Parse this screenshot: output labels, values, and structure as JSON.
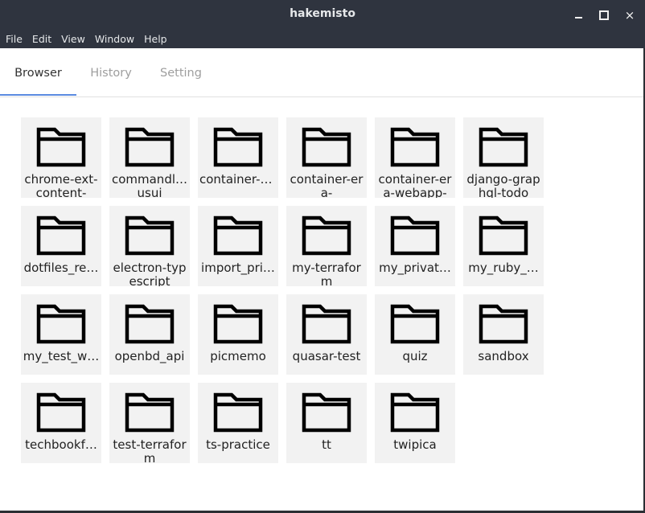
{
  "window": {
    "title": "hakemisto",
    "controls": {
      "minimize": "minimize",
      "maximize": "maximize",
      "close": "×"
    }
  },
  "menu": [
    "File",
    "Edit",
    "Window",
    "Help"
  ],
  "menu_labels": {
    "file": "File",
    "edit": "Edit",
    "view": "View",
    "window": "Window",
    "help": "Help"
  },
  "tabs": [
    {
      "label": "Browser",
      "active": true
    },
    {
      "label": "History",
      "active": false
    },
    {
      "label": "Setting",
      "active": false
    }
  ],
  "folders": [
    {
      "name": "chrome-ext-content-",
      "wrap": true
    },
    {
      "name": "commandl…usui",
      "wrap": true
    },
    {
      "name": "container-era",
      "wrap": false
    },
    {
      "name": "container-era-",
      "wrap": true
    },
    {
      "name": "container-era-webapp-",
      "wrap": true
    },
    {
      "name": "django-graphql-todo",
      "wrap": true
    },
    {
      "name": "dotfiles_re…",
      "wrap": false
    },
    {
      "name": "electron-typescript",
      "wrap": true
    },
    {
      "name": "import_pri…",
      "wrap": false
    },
    {
      "name": "my-terraform",
      "wrap": true
    },
    {
      "name": "my_privat…",
      "wrap": false
    },
    {
      "name": "my_ruby_…",
      "wrap": false
    },
    {
      "name": "my_test_w…",
      "wrap": false
    },
    {
      "name": "openbd_api",
      "wrap": false
    },
    {
      "name": "picmemo",
      "wrap": false
    },
    {
      "name": "quasar-test",
      "wrap": false
    },
    {
      "name": "quiz",
      "wrap": false
    },
    {
      "name": "sandbox",
      "wrap": false
    },
    {
      "name": "techbookf…",
      "wrap": false
    },
    {
      "name": "test-terraform",
      "wrap": true
    },
    {
      "name": "ts-practice",
      "wrap": false
    },
    {
      "name": "tt",
      "wrap": false
    },
    {
      "name": "twipica",
      "wrap": false
    }
  ],
  "colors": {
    "titlebar": "#2f343f",
    "tab_indicator": "#5b8be0",
    "tile_bg": "#f2f2f2"
  },
  "icons": {
    "folder": "folder-icon"
  }
}
